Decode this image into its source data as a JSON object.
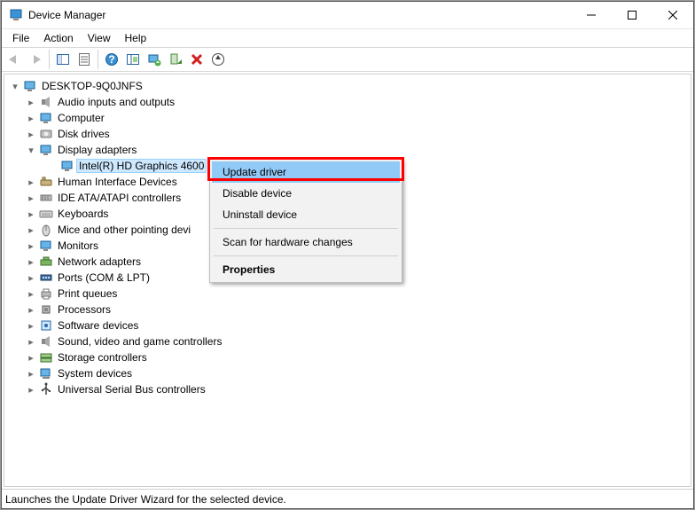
{
  "window": {
    "title": "Device Manager"
  },
  "menu": {
    "file": "File",
    "action": "Action",
    "view": "View",
    "help": "Help"
  },
  "toolbar": {
    "back": "Back",
    "forward": "Forward",
    "show_hide_tree": "Show/Hide Console Tree",
    "properties": "Properties",
    "help": "Help",
    "refresh": "Refresh",
    "update": "Update Driver Software",
    "enable": "Enable Device",
    "uninstall": "Uninstall Device",
    "scan": "Scan for hardware changes"
  },
  "tree": {
    "root": "DESKTOP-9Q0JNFS",
    "categories": [
      {
        "label": "Audio inputs and outputs",
        "icon": "speaker-icon"
      },
      {
        "label": "Computer",
        "icon": "monitor-icon"
      },
      {
        "label": "Disk drives",
        "icon": "disk-icon"
      },
      {
        "label": "Display adapters",
        "icon": "monitor-icon",
        "expanded": true,
        "children": [
          {
            "label": "Intel(R) HD Graphics 4600",
            "icon": "monitor-icon",
            "selected": true
          }
        ]
      },
      {
        "label": "Human Interface Devices",
        "icon": "hid-icon"
      },
      {
        "label": "IDE ATA/ATAPI controllers",
        "icon": "ide-icon"
      },
      {
        "label": "Keyboards",
        "icon": "keyboard-icon"
      },
      {
        "label": "Mice and other pointing devices",
        "icon": "mouse-icon",
        "truncated": "Mice and other pointing devi"
      },
      {
        "label": "Monitors",
        "icon": "monitor-icon"
      },
      {
        "label": "Network adapters",
        "icon": "network-icon"
      },
      {
        "label": "Ports (COM & LPT)",
        "icon": "port-icon"
      },
      {
        "label": "Print queues",
        "icon": "printer-icon"
      },
      {
        "label": "Processors",
        "icon": "cpu-icon"
      },
      {
        "label": "Software devices",
        "icon": "software-icon"
      },
      {
        "label": "Sound, video and game controllers",
        "icon": "speaker-icon"
      },
      {
        "label": "Storage controllers",
        "icon": "storage-icon"
      },
      {
        "label": "System devices",
        "icon": "system-icon"
      },
      {
        "label": "Universal Serial Bus controllers",
        "icon": "usb-icon"
      }
    ]
  },
  "context_menu": {
    "update": "Update driver",
    "disable": "Disable device",
    "uninstall": "Uninstall device",
    "scan": "Scan for hardware changes",
    "properties": "Properties"
  },
  "status": "Launches the Update Driver Wizard for the selected device."
}
